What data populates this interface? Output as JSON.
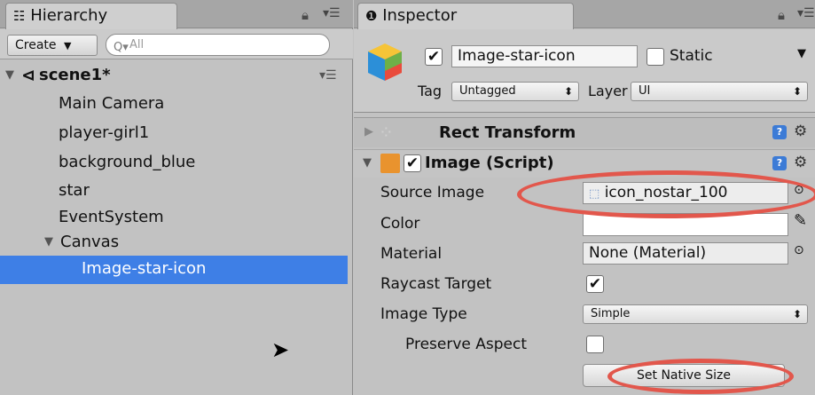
{
  "hierarchy": {
    "tab_label": "Hierarchy",
    "create_label": "Create",
    "search_placeholder": "All",
    "scene_name": "scene1*",
    "items": [
      {
        "label": "Main Camera"
      },
      {
        "label": "player-girl1"
      },
      {
        "label": "background_blue"
      },
      {
        "label": "star"
      },
      {
        "label": "EventSystem"
      },
      {
        "label": "Canvas"
      },
      {
        "label": "Image-star-icon"
      }
    ]
  },
  "inspector": {
    "tab_label": "Inspector",
    "object_name": "Image-star-icon",
    "static_label": "Static",
    "tag_label": "Tag",
    "tag_value": "Untagged",
    "layer_label": "Layer",
    "layer_value": "UI",
    "rect_transform_label": "Rect Transform",
    "image_component_label": "Image (Script)",
    "props": {
      "source_image_label": "Source Image",
      "source_image_value": "icon_nostar_100",
      "color_label": "Color",
      "material_label": "Material",
      "material_value": "None (Material)",
      "raycast_label": "Raycast Target",
      "image_type_label": "Image Type",
      "image_type_value": "Simple",
      "preserve_label": "Preserve Aspect"
    },
    "set_native_size_label": "Set Native Size"
  },
  "colors": {
    "selection": "#3e7fe6",
    "highlight_oval": "#e2574c"
  }
}
